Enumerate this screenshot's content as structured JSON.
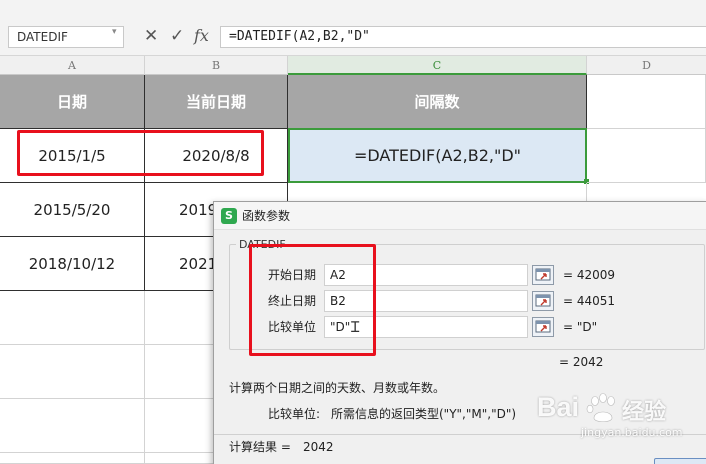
{
  "formula_bar": {
    "name_box": "DATEDIF",
    "cancel_icon": "✕",
    "confirm_icon": "✓",
    "fx_label": "fx",
    "formula": "=DATEDIF(A2,B2,\"D\""
  },
  "columns": [
    "A",
    "B",
    "C",
    "D"
  ],
  "sheet": {
    "header": [
      "日期",
      "当前日期",
      "间隔数"
    ],
    "rows": [
      {
        "a": "2015/1/5",
        "b": "2020/8/8",
        "c": "=DATEDIF(A2,B2,\"D\""
      },
      {
        "a": "2015/5/20",
        "b": "2019"
      },
      {
        "a": "2018/10/12",
        "b": "2021"
      }
    ]
  },
  "dialog": {
    "title": "函数参数",
    "app_icon": "S",
    "function_name": "DATEDIF",
    "args": [
      {
        "label": "开始日期",
        "value": "A2",
        "result": "= 42009"
      },
      {
        "label": "终止日期",
        "value": "B2",
        "result": "= 44051"
      },
      {
        "label": "比较单位",
        "value": "\"D\"",
        "result": "= \"D\""
      }
    ],
    "formula_result": "= 2042",
    "description": "计算两个日期之间的天数、月数或年数。",
    "param_help_label": "比较单位:",
    "param_help_text": "所需信息的返回类型(\"Y\",\"M\",\"D\")",
    "calc_result_label": "计算结果 =",
    "calc_result_value": "2042"
  },
  "watermark": {
    "brand": "Bai",
    "brand_suffix": "经验",
    "url": "jingyan.baidu.com"
  },
  "colors": {
    "header_fill": "#a6a6a6",
    "active_cell_fill": "#dce8f4",
    "selection_green": "#3b9b3b",
    "highlight_red": "#e8101d"
  }
}
